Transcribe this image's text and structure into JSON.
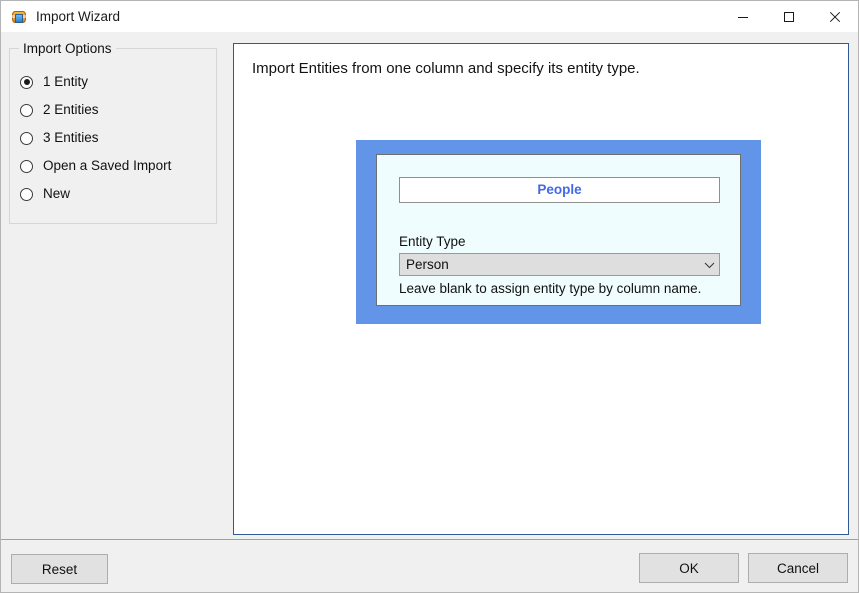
{
  "window": {
    "title": "Import Wizard",
    "icon": "database-import-icon",
    "controls": {
      "minimize": "minimize-icon",
      "maximize": "maximize-icon",
      "close": "close-icon"
    }
  },
  "import_options": {
    "legend": "Import Options",
    "items": [
      {
        "label": "1 Entity",
        "selected": true
      },
      {
        "label": "2 Entities",
        "selected": false
      },
      {
        "label": "3 Entities",
        "selected": false
      },
      {
        "label": "Open a Saved Import",
        "selected": false
      },
      {
        "label": "New",
        "selected": false
      }
    ]
  },
  "main": {
    "heading": "Import Entities from one column and specify its entity type.",
    "card": {
      "column_name": "People",
      "entity_type_label": "Entity Type",
      "entity_type_value": "Person",
      "entity_type_arrow": "chevron-down-icon",
      "hint": "Leave blank to assign entity type by column name."
    }
  },
  "footer": {
    "reset_label": "Reset",
    "ok_label": "OK",
    "cancel_label": "Cancel"
  },
  "colors": {
    "card_border": "#6294e8",
    "card_background": "#effdff",
    "column_name_text": "#4169e8",
    "panel_border": "#2f5a96",
    "window_background": "#f0f0f0"
  }
}
